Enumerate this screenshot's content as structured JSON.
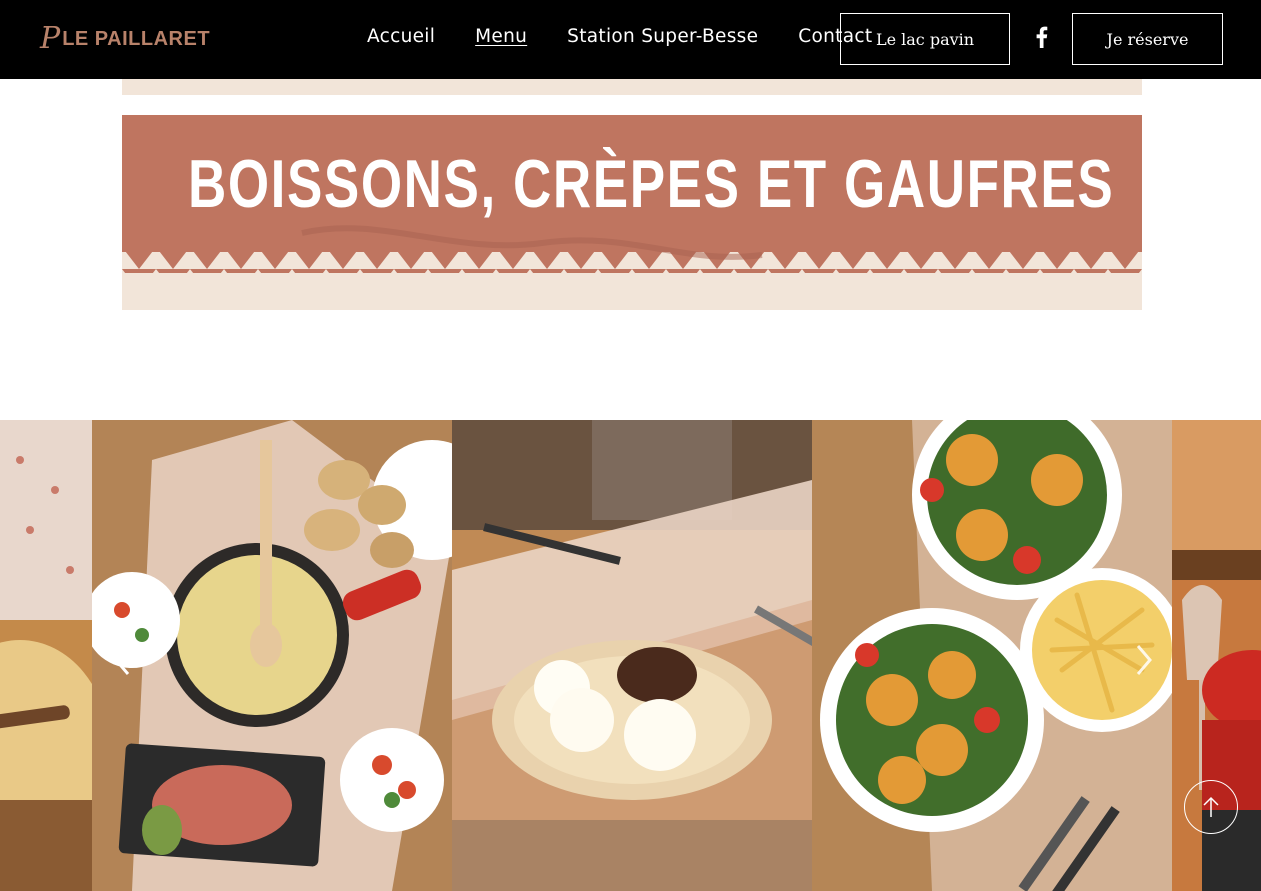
{
  "header": {
    "logo_mark": "P",
    "logo_text": "LE PAILLARET",
    "nav": [
      {
        "label": "Accueil",
        "active": false
      },
      {
        "label": "Menu",
        "active": true
      },
      {
        "label": "Station Super-Besse",
        "active": false
      },
      {
        "label": "Contact",
        "active": false
      }
    ],
    "lac_button": "Le lac pavin",
    "social_icon": "facebook-icon",
    "reserve_button": "Je réserve"
  },
  "banner": {
    "title": "BOISSONS, CRÈPES ET GAUFRES"
  },
  "gallery": {
    "slides": [
      {
        "name": "raclette-partial"
      },
      {
        "name": "fondue-potatoes-charcuterie"
      },
      {
        "name": "chocolate-cake-cream"
      },
      {
        "name": "salads-fries"
      },
      {
        "name": "fondue-glasses-partial"
      }
    ],
    "prev_icon": "chevron-left-icon",
    "next_icon": "chevron-right-icon",
    "scroll_top_icon": "arrow-up-icon"
  },
  "colors": {
    "header_bg": "#000000",
    "brand": "#b8826a",
    "banner_bg": "#f2e5d9",
    "banner_band": "#bf7560"
  }
}
